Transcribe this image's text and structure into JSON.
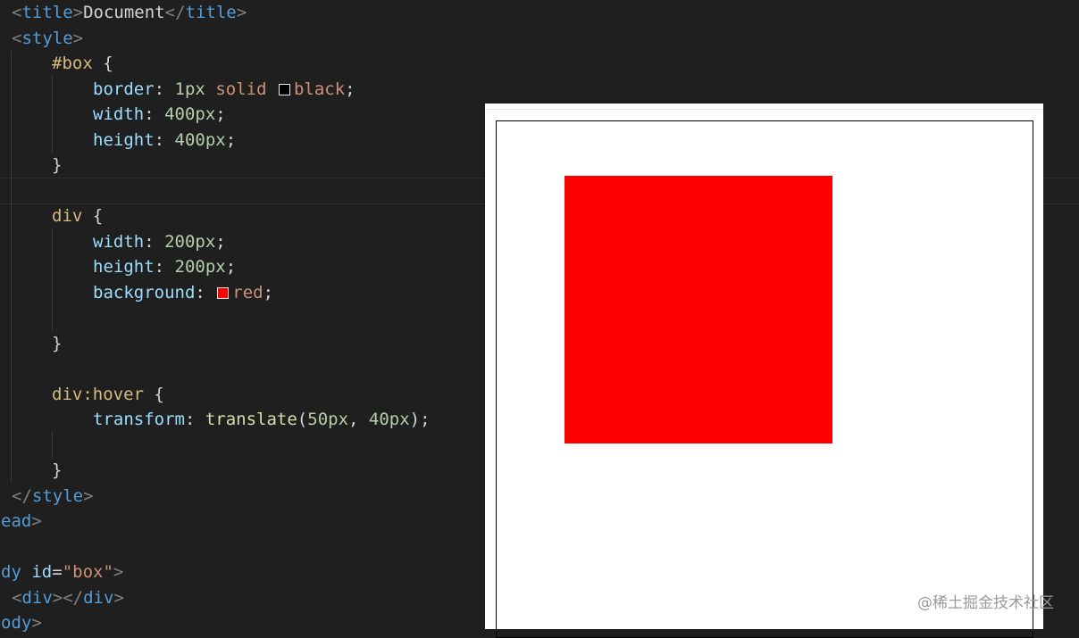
{
  "colors": {
    "editor_bg": "#1f1f1f",
    "tag": "#569cd6",
    "selector": "#d7ba7d",
    "property": "#9cdcfe",
    "number": "#b5cea8",
    "value": "#ce9178",
    "function": "#dcdcaa",
    "preview_bg": "#ffffff",
    "box_border": "#000000",
    "red_fill": "#ff0000"
  },
  "code": {
    "l1": {
      "open_lt": "<",
      "tag": "title",
      "gt": ">",
      "text": "Document",
      "close_lt": "</",
      "close_tag": "title",
      "close_gt": ">"
    },
    "l2": {
      "lt": "<",
      "tag": "style",
      "gt": ">"
    },
    "l3": {
      "selector": "#box",
      "brace": " {"
    },
    "l4": {
      "prop": "border",
      "colon": ": ",
      "num": "1px",
      "sp": " ",
      "val1": "solid",
      "sp2": " ",
      "swatch_color": "black",
      "val2": "black",
      "semi": ";"
    },
    "l5": {
      "prop": "width",
      "colon": ": ",
      "num": "400px",
      "semi": ";"
    },
    "l6": {
      "prop": "height",
      "colon": ": ",
      "num": "400px",
      "semi": ";"
    },
    "l7": {
      "brace": "}"
    },
    "l8": {
      "selector": "div",
      "brace": " {"
    },
    "l9": {
      "prop": "width",
      "colon": ": ",
      "num": "200px",
      "semi": ";"
    },
    "l10": {
      "prop": "height",
      "colon": ": ",
      "num": "200px",
      "semi": ";"
    },
    "l11": {
      "prop": "background",
      "colon": ": ",
      "swatch_color": "red",
      "val": "red",
      "semi": ";"
    },
    "l12": {
      "brace": "}"
    },
    "l13": {
      "selector": "div:hover",
      "brace": " {"
    },
    "l14": {
      "prop": "transform",
      "colon": ": ",
      "fn": "translate",
      "paren_open": "(",
      "num1": "50px",
      "comma": ", ",
      "num2": "40px",
      "paren_close": ")",
      "semi": ";"
    },
    "l15": {
      "brace": "}"
    },
    "l16": {
      "lt": "</",
      "tag": "style",
      "gt": ">"
    },
    "l17": {
      "tag": "ead",
      "gt": ">"
    },
    "l18": {
      "tag": "dy",
      "sp": " ",
      "attr": "id",
      "eq": "=",
      "str": "\"box\"",
      "gt": ">"
    },
    "l19": {
      "lt": "<",
      "tag": "div",
      "gt": "></",
      "tag2": "div",
      "gt2": ">"
    },
    "l20": {
      "tag": "ody",
      "gt": ">"
    }
  },
  "watermark": "@稀土掘金技术社区"
}
